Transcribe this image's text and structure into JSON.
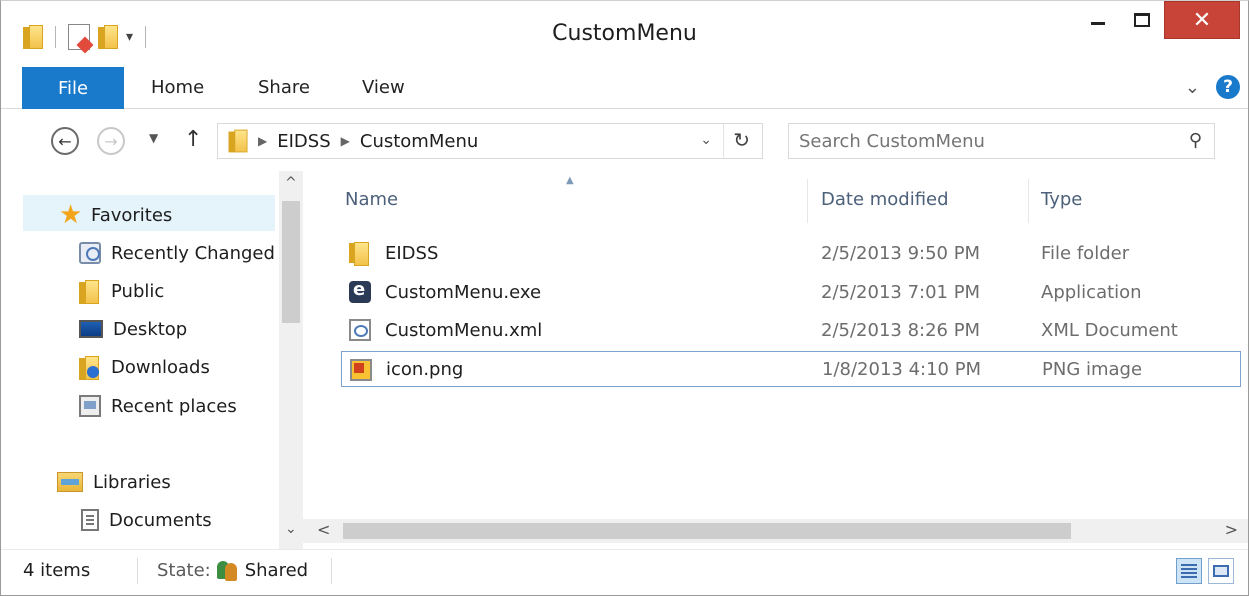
{
  "window": {
    "title": "CustomMenu",
    "close_glyph": "✕"
  },
  "ribbon": {
    "tabs": [
      "File",
      "Home",
      "Share",
      "View"
    ]
  },
  "address": {
    "breadcrumb": [
      "EIDSS",
      "CustomMenu"
    ],
    "search_placeholder": "Search CustomMenu"
  },
  "nav": {
    "items": [
      {
        "label": "Favorites",
        "icon": "star-icon"
      },
      {
        "label": "Recently Changed",
        "icon": "recent-changes-icon"
      },
      {
        "label": "Public",
        "icon": "folder-icon"
      },
      {
        "label": "Desktop",
        "icon": "desktop-icon"
      },
      {
        "label": "Downloads",
        "icon": "downloads-icon"
      },
      {
        "label": "Recent places",
        "icon": "recent-places-icon"
      },
      {
        "label": "Libraries",
        "icon": "libraries-icon"
      },
      {
        "label": "Documents",
        "icon": "documents-icon"
      }
    ]
  },
  "columns": {
    "name": "Name",
    "date": "Date modified",
    "type": "Type"
  },
  "files": [
    {
      "name": "EIDSS",
      "date": "2/5/2013 9:50 PM",
      "type": "File folder",
      "icon": "folder-icon"
    },
    {
      "name": "CustomMenu.exe",
      "date": "2/5/2013 7:01 PM",
      "type": "Application",
      "icon": "exe-icon"
    },
    {
      "name": "CustomMenu.xml",
      "date": "2/5/2013 8:26 PM",
      "type": "XML Document",
      "icon": "xml-icon"
    },
    {
      "name": "icon.png",
      "date": "1/8/2013 4:10 PM",
      "type": "PNG image",
      "icon": "png-icon"
    }
  ],
  "status": {
    "count": "4 items",
    "state_label": "State:",
    "state_value": "Shared"
  },
  "colors": {
    "accent": "#1979ca",
    "close": "#c94438",
    "selection": "#e5f3fb",
    "focus_border": "#7da2ce"
  }
}
